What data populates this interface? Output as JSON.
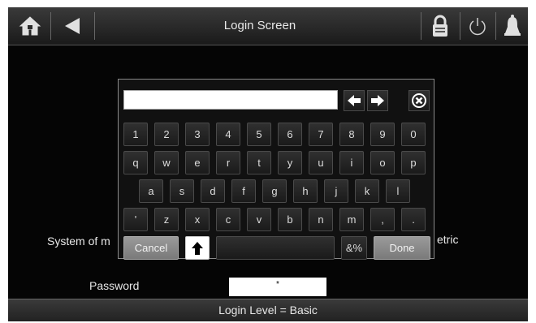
{
  "header": {
    "title": "Login Screen"
  },
  "icons": {
    "home": "home-icon",
    "back": "back-arrow-icon",
    "lock": "lock-icon",
    "power": "power-icon",
    "alarm": "bell-icon"
  },
  "form": {
    "system_label_left": "System of m",
    "system_label_right": "etric",
    "password_label": "Password",
    "password_value": "*"
  },
  "keyboard": {
    "input_value": "",
    "row1": [
      "1",
      "2",
      "3",
      "4",
      "5",
      "6",
      "7",
      "8",
      "9",
      "0"
    ],
    "row2": [
      "q",
      "w",
      "e",
      "r",
      "t",
      "y",
      "u",
      "i",
      "o",
      "p"
    ],
    "row3": [
      "a",
      "s",
      "d",
      "f",
      "g",
      "h",
      "j",
      "k",
      "l"
    ],
    "row4": [
      "'",
      "z",
      "x",
      "c",
      "v",
      "b",
      "n",
      "m",
      ",",
      "."
    ],
    "cancel_label": "Cancel",
    "symbols_label": "&%",
    "done_label": "Done"
  },
  "footer": {
    "status": "Login Level = Basic"
  }
}
